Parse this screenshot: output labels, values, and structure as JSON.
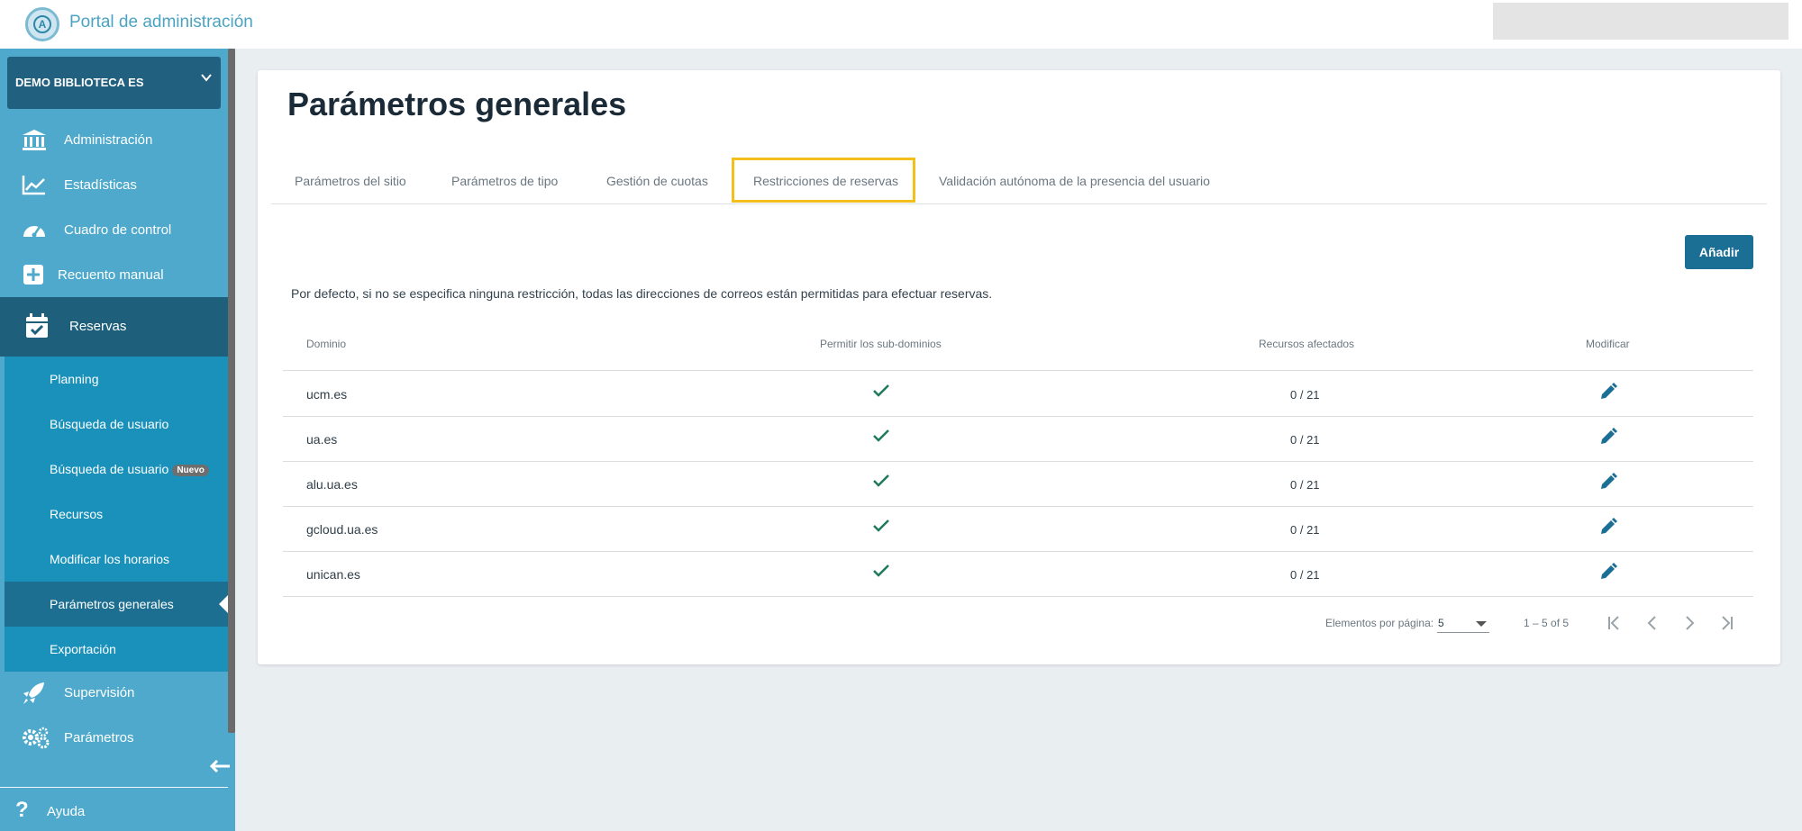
{
  "header": {
    "app_title": "Portal de administración",
    "logo_letter": "A"
  },
  "sidebar": {
    "site_selector": "DEMO BIBLIOTECA ES",
    "items": [
      {
        "label": "Administración",
        "icon": "bank-icon"
      },
      {
        "label": "Estadísticas",
        "icon": "chart-icon"
      },
      {
        "label": "Cuadro de control",
        "icon": "gauge-icon"
      },
      {
        "label": "Recuento manual",
        "icon": "plus-square-icon"
      },
      {
        "label": "Reservas",
        "icon": "calendar-check-icon"
      },
      {
        "label": "Supervisión",
        "icon": "rocket-icon"
      },
      {
        "label": "Parámetros",
        "icon": "gears-icon"
      }
    ],
    "sub_items": [
      {
        "label": "Planning"
      },
      {
        "label": "Búsqueda de usuario"
      },
      {
        "label": "Búsqueda de usuario",
        "badge": "Nuevo"
      },
      {
        "label": "Recursos"
      },
      {
        "label": "Modificar los horarios"
      },
      {
        "label": "Parámetros generales"
      },
      {
        "label": "Exportación"
      }
    ],
    "help": "Ayuda"
  },
  "main": {
    "title": "Parámetros generales",
    "tabs": [
      {
        "label": "Parámetros del sitio"
      },
      {
        "label": "Parámetros de tipo"
      },
      {
        "label": "Gestión de cuotas"
      },
      {
        "label": "Restricciones de reservas"
      },
      {
        "label": "Validación autónoma de la presencia del usuario"
      }
    ],
    "add_button": "Añadir",
    "info": "Por defecto, si no se especifica ninguna restricción, todas las direcciones de correos están permitidas para efectuar reservas.",
    "table": {
      "headers": [
        "Dominio",
        "Permitir los sub-dominios",
        "Recursos afectados",
        "Modificar"
      ],
      "rows": [
        {
          "domain": "ucm.es",
          "subdomains": true,
          "resources": "0 / 21"
        },
        {
          "domain": "ua.es",
          "subdomains": true,
          "resources": "0 / 21"
        },
        {
          "domain": "alu.ua.es",
          "subdomains": true,
          "resources": "0 / 21"
        },
        {
          "domain": "gcloud.ua.es",
          "subdomains": true,
          "resources": "0 / 21"
        },
        {
          "domain": "unican.es",
          "subdomains": true,
          "resources": "0 / 21"
        }
      ]
    },
    "pagination": {
      "per_page_label": "Elementos por página:",
      "per_page_value": "5",
      "range": "1 – 5 of 5"
    }
  },
  "colors": {
    "sidebar": "#4fa9cc",
    "sidebar_active": "#1e5f7c",
    "submenu": "#1991bb",
    "primary_button": "#1b6f95",
    "check": "#1f7a5a",
    "edit": "#1b6f95",
    "highlight": "#f3bf1c"
  }
}
